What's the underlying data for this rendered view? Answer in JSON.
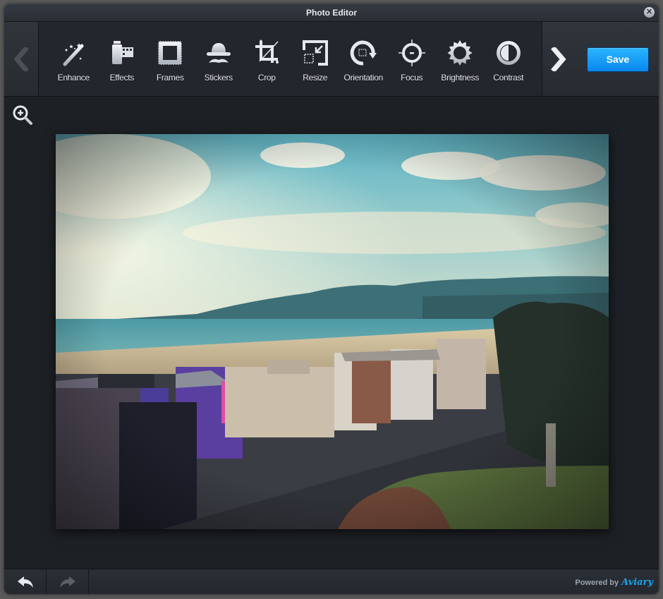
{
  "window": {
    "title": "Photo Editor",
    "close_icon": "close-icon"
  },
  "toolbar": {
    "prev_icon": "chevron-left-icon",
    "next_icon": "chevron-right-icon",
    "save_label": "Save",
    "tools": [
      {
        "label": "Enhance",
        "icon": "magic-wand-icon"
      },
      {
        "label": "Effects",
        "icon": "film-roll-icon"
      },
      {
        "label": "Frames",
        "icon": "frame-icon"
      },
      {
        "label": "Stickers",
        "icon": "hat-mustache-icon"
      },
      {
        "label": "Crop",
        "icon": "crop-icon"
      },
      {
        "label": "Resize",
        "icon": "resize-icon"
      },
      {
        "label": "Orientation",
        "icon": "rotate-icon"
      },
      {
        "label": "Focus",
        "icon": "crosshair-icon"
      },
      {
        "label": "Brightness",
        "icon": "sun-icon"
      },
      {
        "label": "Contrast",
        "icon": "contrast-icon"
      }
    ]
  },
  "canvas": {
    "zoom_icon": "zoom-in-icon",
    "photo_description": "Coastal town with beach, ocean and mountains under cloudy sky"
  },
  "footer": {
    "undo_icon": "undo-icon",
    "redo_icon": "redo-icon",
    "powered_by": "Powered by",
    "brand": "Aviary"
  },
  "colors": {
    "accent": "#1a9bf5",
    "background": "#1d2024",
    "toolbar": "#23272d"
  }
}
